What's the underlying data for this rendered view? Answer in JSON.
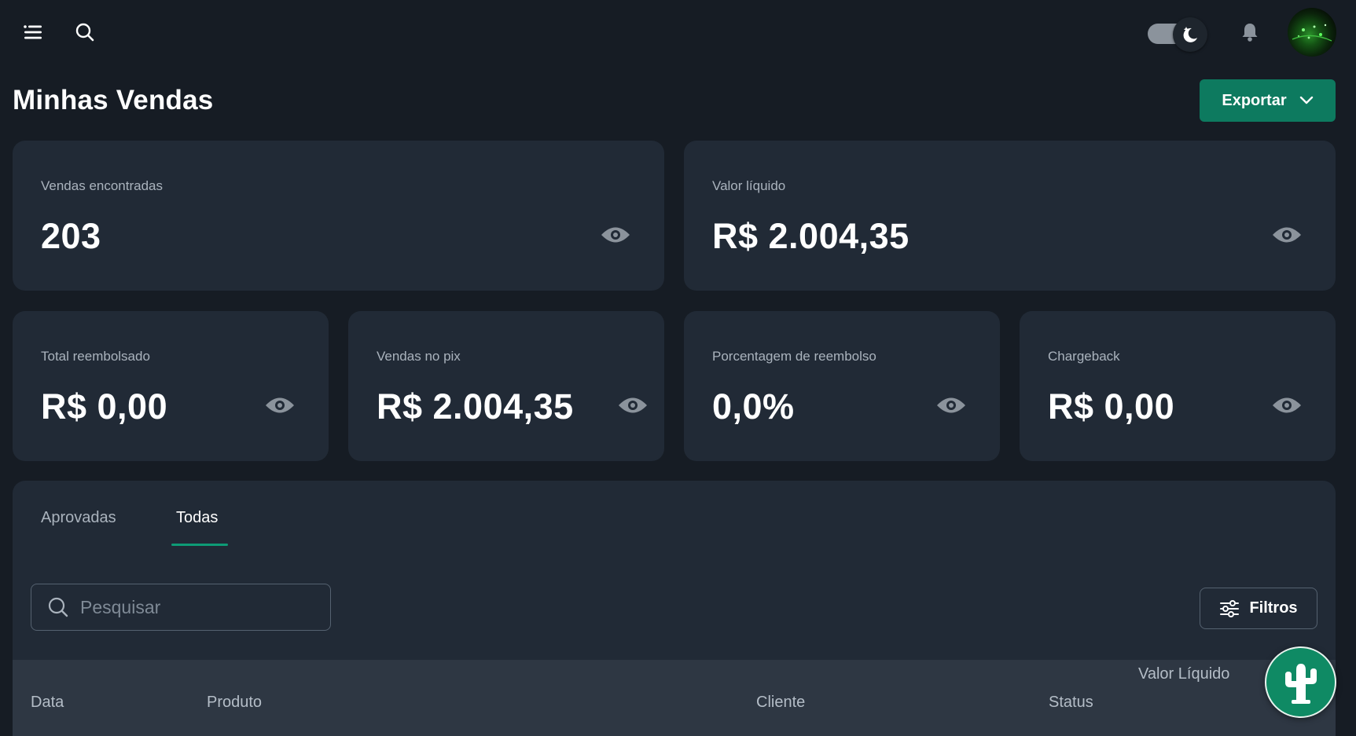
{
  "header": {
    "menu_icon": "hamburger-menu-icon",
    "search_icon": "search-icon",
    "theme_icon": "moon-icon",
    "bell_icon": "bell-icon"
  },
  "page": {
    "title": "Minhas Vendas",
    "export_label": "Exportar"
  },
  "stats": {
    "vendas_encontradas": {
      "label": "Vendas encontradas",
      "value": "203"
    },
    "valor_liquido": {
      "label": "Valor líquido",
      "value": "R$ 2.004,35"
    },
    "total_reembolsado": {
      "label": "Total reembolsado",
      "value": "R$ 0,00"
    },
    "vendas_no_pix": {
      "label": "Vendas no pix",
      "value": "R$ 2.004,35"
    },
    "porcentagem_reembolso": {
      "label": "Porcentagem de reembolso",
      "value": "0,0%"
    },
    "chargeback": {
      "label": "Chargeback",
      "value": "R$ 0,00"
    }
  },
  "tabs": [
    {
      "label": "Aprovadas",
      "active": false
    },
    {
      "label": "Todas",
      "active": true
    }
  ],
  "search": {
    "placeholder": "Pesquisar",
    "value": ""
  },
  "filters_label": "Filtros",
  "table": {
    "columns": [
      "Data",
      "Produto",
      "Cliente",
      "Status",
      "Valor Líquido"
    ]
  },
  "colors": {
    "background": "#161c24",
    "card": "#212a36",
    "accent": "#0d7a5f",
    "table_header": "#2e3743"
  }
}
